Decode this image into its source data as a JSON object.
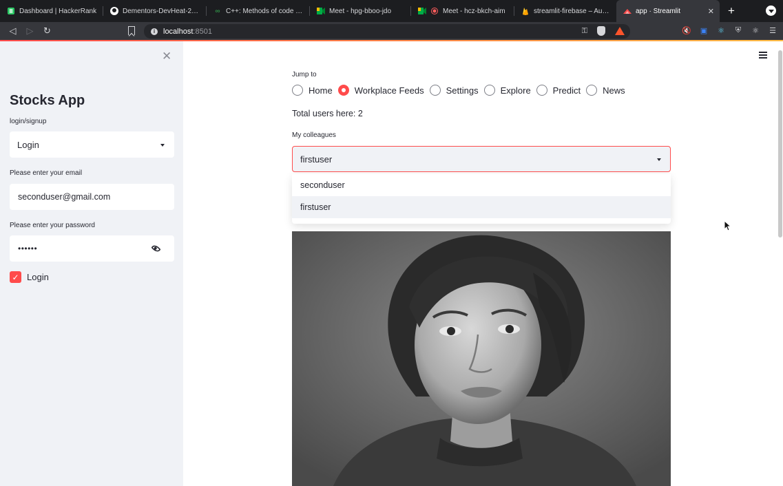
{
  "browser": {
    "tabs": [
      {
        "title": "Dashboard | HackerRank",
        "icon": "hackerrank-icon"
      },
      {
        "title": "Dementors-DevHeat-2021/",
        "icon": "github-icon"
      },
      {
        "title": "C++: Methods of code sho",
        "icon": "geeksforgeeks-icon"
      },
      {
        "title": "Meet - hpg-bboo-jdo",
        "icon": "meet-icon"
      },
      {
        "title": "Meet - hcz-bkch-aim",
        "icon": "meet-icon"
      },
      {
        "title": "streamlit-firebase – Auther",
        "icon": "firebase-icon"
      },
      {
        "title": "app · Streamlit",
        "icon": "streamlit-icon",
        "active": true
      }
    ],
    "url_host": "localhost",
    "url_port": ":8501"
  },
  "sidebar": {
    "title": "Stocks App",
    "select_label": "login/signup",
    "select_value": "Login",
    "email_label": "Please enter your email",
    "email_value": "seconduser@gmail.com",
    "password_label": "Please enter your password",
    "password_value": "••••••",
    "checkbox_label": "Login",
    "checkbox_checked": true
  },
  "main": {
    "jump_label": "Jump to",
    "radio_options": [
      "Home",
      "Workplace Feeds",
      "Settings",
      "Explore",
      "Predict",
      "News"
    ],
    "radio_selected": "Workplace Feeds",
    "total_users": "Total users here: 2",
    "colleagues_label": "My colleagues",
    "colleague_value": "firstuser",
    "dropdown_options": [
      "seconduser",
      "firstuser"
    ],
    "dropdown_highlighted": "firstuser"
  },
  "colors": {
    "accent": "#ff4b4b",
    "sidebar_bg": "#f0f2f6",
    "text": "#262730"
  }
}
